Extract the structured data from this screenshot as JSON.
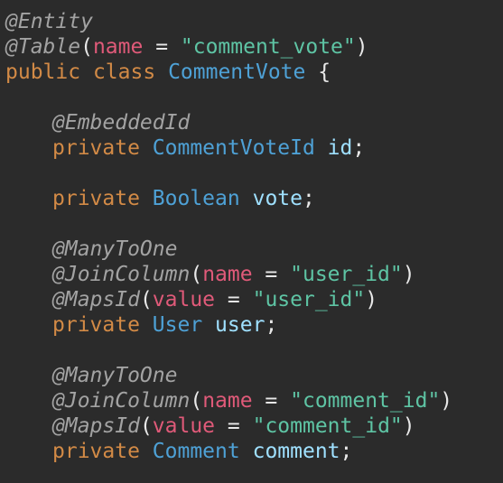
{
  "code": {
    "line1": {
      "annotation": "@Entity"
    },
    "line2": {
      "annotation": "@Table",
      "open": "(",
      "param": "name",
      "eq": " = ",
      "value": "\"comment_vote\"",
      "close": ")"
    },
    "line3": {
      "kw1": "public",
      "kw2": "class",
      "class_name": "CommentVote",
      "brace": "{"
    },
    "line5": {
      "annotation": "@EmbeddedId"
    },
    "line6": {
      "kw": "private",
      "type": "CommentVoteId",
      "name": "id",
      "semi": ";"
    },
    "line8": {
      "kw": "private",
      "type": "Boolean",
      "name": "vote",
      "semi": ";"
    },
    "line10": {
      "annotation": "@ManyToOne"
    },
    "line11": {
      "annotation": "@JoinColumn",
      "open": "(",
      "param": "name",
      "eq": " = ",
      "value": "\"user_id\"",
      "close": ")"
    },
    "line12": {
      "annotation": "@MapsId",
      "open": "(",
      "param": "value",
      "eq": " = ",
      "value": "\"user_id\"",
      "close": ")"
    },
    "line13": {
      "kw": "private",
      "type": "User",
      "name": "user",
      "semi": ";"
    },
    "line15": {
      "annotation": "@ManyToOne"
    },
    "line16": {
      "annotation": "@JoinColumn",
      "open": "(",
      "param": "name",
      "eq": " = ",
      "value": "\"comment_id\"",
      "close": ")"
    },
    "line17": {
      "annotation": "@MapsId",
      "open": "(",
      "param": "value",
      "eq": " = ",
      "value": "\"comment_id\"",
      "close": ")"
    },
    "line18": {
      "kw": "private",
      "type": "Comment",
      "name": "comment",
      "semi": ";"
    }
  }
}
